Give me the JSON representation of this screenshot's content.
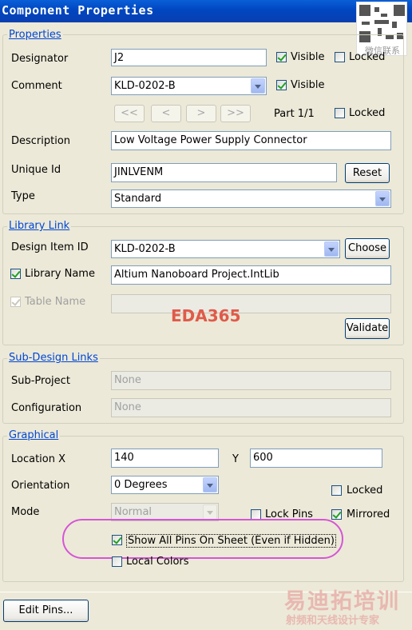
{
  "window": {
    "title": "Component Properties"
  },
  "properties": {
    "group_label": "Properties",
    "designator_label": "Designator",
    "designator_value": "J2",
    "designator_visible_label": "Visible",
    "designator_locked_label": "Locked",
    "comment_label": "Comment",
    "comment_value": "KLD-0202-B",
    "comment_visible_label": "Visible",
    "nav_first": "<<",
    "nav_prev": "<",
    "nav_next": ">",
    "nav_last": ">>",
    "part_label": "Part 1/1",
    "part_locked_label": "Locked",
    "description_label": "Description",
    "description_value": "Low Voltage Power Supply Connector",
    "unique_id_label": "Unique Id",
    "unique_id_value": "JINLVENM",
    "reset_label": "Reset",
    "type_label": "Type",
    "type_value": "Standard"
  },
  "library_link": {
    "group_label": "Library Link",
    "design_item_label": "Design Item ID",
    "design_item_value": "KLD-0202-B",
    "choose_label": "Choose",
    "library_name_label": "Library Name",
    "library_name_value": "Altium Nanoboard Project.IntLib",
    "table_name_label": "Table Name",
    "table_name_value": "",
    "validate_label": "Validate"
  },
  "sub_design": {
    "group_label": "Sub-Design Links",
    "sub_project_label": "Sub-Project",
    "sub_project_value": "None",
    "configuration_label": "Configuration",
    "configuration_value": "None"
  },
  "graphical": {
    "group_label": "Graphical",
    "location_label": "Location X",
    "location_x_value": "140",
    "y_label": "Y",
    "location_y_value": "600",
    "orientation_label": "Orientation",
    "orientation_value": "0 Degrees",
    "locked_label": "Locked",
    "mode_label": "Mode",
    "mode_value": "Normal",
    "lock_pins_label": "Lock Pins",
    "mirrored_label": "Mirrored",
    "show_all_pins_label": "Show All Pins On Sheet (Even if Hidden)",
    "local_colors_label": "Local Colors"
  },
  "footer": {
    "edit_pins_label": "Edit Pins..."
  },
  "watermarks": {
    "center": "EDA365",
    "brand_line1": "易迪拓培训",
    "brand_line2": "射频和天线设计专家",
    "qr_caption": "微信联系"
  },
  "colors": {
    "titlebar": "#0046c0",
    "group_label": "#0046d5",
    "highlight_oval": "#d655d6",
    "watermark": "#e05a4a"
  },
  "checkboxes": {
    "designator_visible": true,
    "designator_locked": false,
    "comment_visible": true,
    "part_locked": false,
    "library_name": true,
    "table_name": true,
    "graphical_locked": false,
    "lock_pins": false,
    "mirrored": true,
    "show_all_pins": true,
    "local_colors": false
  }
}
